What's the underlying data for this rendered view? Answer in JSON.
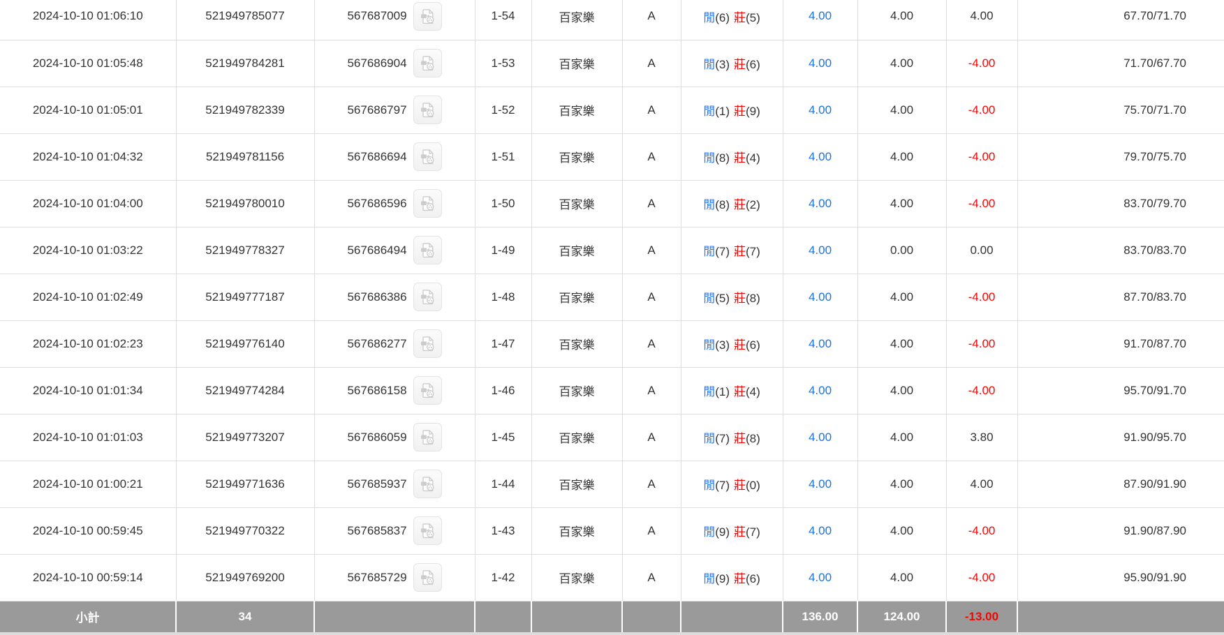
{
  "colors": {
    "link_blue": "#1a73e8",
    "player_blue": "#2979ff",
    "banker_red": "#ff0000",
    "neg_red": "#ff0000",
    "footer_bg": "#9a9a9a"
  },
  "icons": {
    "video_replay": "video-file-icon"
  },
  "table": {
    "result_labels": {
      "player": "閒",
      "banker": "莊"
    },
    "rows": [
      {
        "time": "2024-10-10 01:06:10",
        "bet_id": "521949785077",
        "round_id": "567687009",
        "round": "1-54",
        "game": "百家樂",
        "table": "A",
        "player": 6,
        "banker": 5,
        "bet": "4.00",
        "valid": "4.00",
        "win_loss": "4.00",
        "balance": "67.70/71.70"
      },
      {
        "time": "2024-10-10 01:05:48",
        "bet_id": "521949784281",
        "round_id": "567686904",
        "round": "1-53",
        "game": "百家樂",
        "table": "A",
        "player": 3,
        "banker": 6,
        "bet": "4.00",
        "valid": "4.00",
        "win_loss": "-4.00",
        "balance": "71.70/67.70"
      },
      {
        "time": "2024-10-10 01:05:01",
        "bet_id": "521949782339",
        "round_id": "567686797",
        "round": "1-52",
        "game": "百家樂",
        "table": "A",
        "player": 1,
        "banker": 9,
        "bet": "4.00",
        "valid": "4.00",
        "win_loss": "-4.00",
        "balance": "75.70/71.70"
      },
      {
        "time": "2024-10-10 01:04:32",
        "bet_id": "521949781156",
        "round_id": "567686694",
        "round": "1-51",
        "game": "百家樂",
        "table": "A",
        "player": 8,
        "banker": 4,
        "bet": "4.00",
        "valid": "4.00",
        "win_loss": "-4.00",
        "balance": "79.70/75.70"
      },
      {
        "time": "2024-10-10 01:04:00",
        "bet_id": "521949780010",
        "round_id": "567686596",
        "round": "1-50",
        "game": "百家樂",
        "table": "A",
        "player": 8,
        "banker": 2,
        "bet": "4.00",
        "valid": "4.00",
        "win_loss": "-4.00",
        "balance": "83.70/79.70"
      },
      {
        "time": "2024-10-10 01:03:22",
        "bet_id": "521949778327",
        "round_id": "567686494",
        "round": "1-49",
        "game": "百家樂",
        "table": "A",
        "player": 7,
        "banker": 7,
        "bet": "4.00",
        "valid": "0.00",
        "win_loss": "0.00",
        "balance": "83.70/83.70"
      },
      {
        "time": "2024-10-10 01:02:49",
        "bet_id": "521949777187",
        "round_id": "567686386",
        "round": "1-48",
        "game": "百家樂",
        "table": "A",
        "player": 5,
        "banker": 8,
        "bet": "4.00",
        "valid": "4.00",
        "win_loss": "-4.00",
        "balance": "87.70/83.70"
      },
      {
        "time": "2024-10-10 01:02:23",
        "bet_id": "521949776140",
        "round_id": "567686277",
        "round": "1-47",
        "game": "百家樂",
        "table": "A",
        "player": 3,
        "banker": 6,
        "bet": "4.00",
        "valid": "4.00",
        "win_loss": "-4.00",
        "balance": "91.70/87.70"
      },
      {
        "time": "2024-10-10 01:01:34",
        "bet_id": "521949774284",
        "round_id": "567686158",
        "round": "1-46",
        "game": "百家樂",
        "table": "A",
        "player": 1,
        "banker": 4,
        "bet": "4.00",
        "valid": "4.00",
        "win_loss": "-4.00",
        "balance": "95.70/91.70"
      },
      {
        "time": "2024-10-10 01:01:03",
        "bet_id": "521949773207",
        "round_id": "567686059",
        "round": "1-45",
        "game": "百家樂",
        "table": "A",
        "player": 7,
        "banker": 8,
        "bet": "4.00",
        "valid": "4.00",
        "win_loss": "3.80",
        "balance": "91.90/95.70"
      },
      {
        "time": "2024-10-10 01:00:21",
        "bet_id": "521949771636",
        "round_id": "567685937",
        "round": "1-44",
        "game": "百家樂",
        "table": "A",
        "player": 7,
        "banker": 0,
        "bet": "4.00",
        "valid": "4.00",
        "win_loss": "4.00",
        "balance": "87.90/91.90"
      },
      {
        "time": "2024-10-10 00:59:45",
        "bet_id": "521949770322",
        "round_id": "567685837",
        "round": "1-43",
        "game": "百家樂",
        "table": "A",
        "player": 9,
        "banker": 7,
        "bet": "4.00",
        "valid": "4.00",
        "win_loss": "-4.00",
        "balance": "91.90/87.90"
      },
      {
        "time": "2024-10-10 00:59:14",
        "bet_id": "521949769200",
        "round_id": "567685729",
        "round": "1-42",
        "game": "百家樂",
        "table": "A",
        "player": 9,
        "banker": 6,
        "bet": "4.00",
        "valid": "4.00",
        "win_loss": "-4.00",
        "balance": "95.90/91.90"
      }
    ],
    "footer": {
      "label": "小計",
      "count": "34",
      "bet_total": "136.00",
      "valid_total": "124.00",
      "win_loss_total": "-13.00"
    }
  }
}
